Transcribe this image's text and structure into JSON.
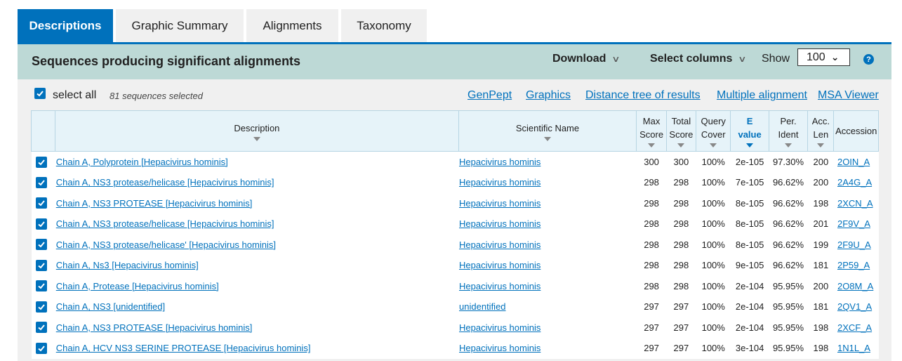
{
  "tabs": [
    {
      "label": "Descriptions",
      "active": true
    },
    {
      "label": "Graphic Summary",
      "active": false
    },
    {
      "label": "Alignments",
      "active": false
    },
    {
      "label": "Taxonomy",
      "active": false
    }
  ],
  "header": {
    "title": "Sequences producing significant alignments",
    "download_label": "Download",
    "select_columns_label": "Select columns",
    "show_label": "Show",
    "show_value": "100",
    "help_symbol": "?"
  },
  "toolbar": {
    "select_all_label": "select all",
    "selected_count": "81 sequences selected",
    "links": [
      "GenPept",
      "Graphics",
      "Distance tree of results",
      "Multiple alignment",
      "MSA Viewer"
    ]
  },
  "table": {
    "columns": [
      {
        "l1": "Description",
        "l2": ""
      },
      {
        "l1": "Scientific Name",
        "l2": ""
      },
      {
        "l1": "Max",
        "l2": "Score"
      },
      {
        "l1": "Total",
        "l2": "Score"
      },
      {
        "l1": "Query",
        "l2": "Cover"
      },
      {
        "l1": "E",
        "l2": "value"
      },
      {
        "l1": "Per.",
        "l2": "Ident"
      },
      {
        "l1": "Acc.",
        "l2": "Len"
      },
      {
        "l1": "Accession",
        "l2": ""
      }
    ],
    "sorted_column": "E value",
    "rows": [
      {
        "checked": true,
        "description": "Chain A, Polyprotein [Hepacivirus hominis]",
        "scientific_name": "Hepacivirus hominis",
        "max_score": "300",
        "total_score": "300",
        "query_cover": "100%",
        "e_value": "2e-105",
        "per_ident": "97.30%",
        "acc_len": "200",
        "accession": "2OIN_A"
      },
      {
        "checked": true,
        "description": "Chain A, NS3 protease/helicase [Hepacivirus hominis]",
        "scientific_name": "Hepacivirus hominis",
        "max_score": "298",
        "total_score": "298",
        "query_cover": "100%",
        "e_value": "7e-105",
        "per_ident": "96.62%",
        "acc_len": "200",
        "accession": "2A4G_A"
      },
      {
        "checked": true,
        "description": "Chain A, NS3 PROTEASE [Hepacivirus hominis]",
        "scientific_name": "Hepacivirus hominis",
        "max_score": "298",
        "total_score": "298",
        "query_cover": "100%",
        "e_value": "8e-105",
        "per_ident": "96.62%",
        "acc_len": "198",
        "accession": "2XCN_A"
      },
      {
        "checked": true,
        "description": "Chain A, NS3 protease/helicase [Hepacivirus hominis]",
        "scientific_name": "Hepacivirus hominis",
        "max_score": "298",
        "total_score": "298",
        "query_cover": "100%",
        "e_value": "8e-105",
        "per_ident": "96.62%",
        "acc_len": "201",
        "accession": "2F9V_A"
      },
      {
        "checked": true,
        "description": "Chain A, NS3 protease/helicase' [Hepacivirus hominis]",
        "scientific_name": "Hepacivirus hominis",
        "max_score": "298",
        "total_score": "298",
        "query_cover": "100%",
        "e_value": "8e-105",
        "per_ident": "96.62%",
        "acc_len": "199",
        "accession": "2F9U_A"
      },
      {
        "checked": true,
        "description": "Chain A, Ns3 [Hepacivirus hominis]",
        "scientific_name": "Hepacivirus hominis",
        "max_score": "298",
        "total_score": "298",
        "query_cover": "100%",
        "e_value": "9e-105",
        "per_ident": "96.62%",
        "acc_len": "181",
        "accession": "2P59_A"
      },
      {
        "checked": true,
        "description": "Chain A, Protease [Hepacivirus hominis]",
        "scientific_name": "Hepacivirus hominis",
        "max_score": "298",
        "total_score": "298",
        "query_cover": "100%",
        "e_value": "2e-104",
        "per_ident": "95.95%",
        "acc_len": "200",
        "accession": "2O8M_A"
      },
      {
        "checked": true,
        "description": "Chain A, NS3 [unidentified]",
        "scientific_name": "unidentified",
        "max_score": "297",
        "total_score": "297",
        "query_cover": "100%",
        "e_value": "2e-104",
        "per_ident": "95.95%",
        "acc_len": "181",
        "accession": "2QV1_A"
      },
      {
        "checked": true,
        "description": "Chain A, NS3 PROTEASE [Hepacivirus hominis]",
        "scientific_name": "Hepacivirus hominis",
        "max_score": "297",
        "total_score": "297",
        "query_cover": "100%",
        "e_value": "2e-104",
        "per_ident": "95.95%",
        "acc_len": "198",
        "accession": "2XCF_A"
      },
      {
        "checked": true,
        "description": "Chain A, HCV NS3 SERINE PROTEASE [Hepacivirus hominis]",
        "scientific_name": "Hepacivirus hominis",
        "max_score": "297",
        "total_score": "297",
        "query_cover": "100%",
        "e_value": "3e-104",
        "per_ident": "95.95%",
        "acc_len": "198",
        "accession": "1N1L_A"
      }
    ]
  },
  "colors": {
    "accent": "#0071bc",
    "header_bar": "#bdd9d6",
    "toolbar_bg": "#f0f0f0",
    "table_header_bg": "#e6f3f9"
  },
  "icons": {
    "checkbox": "checkbox-checked-icon",
    "dropdown": "chevron-down-icon",
    "sort": "sort-down-icon",
    "help": "help-icon"
  }
}
